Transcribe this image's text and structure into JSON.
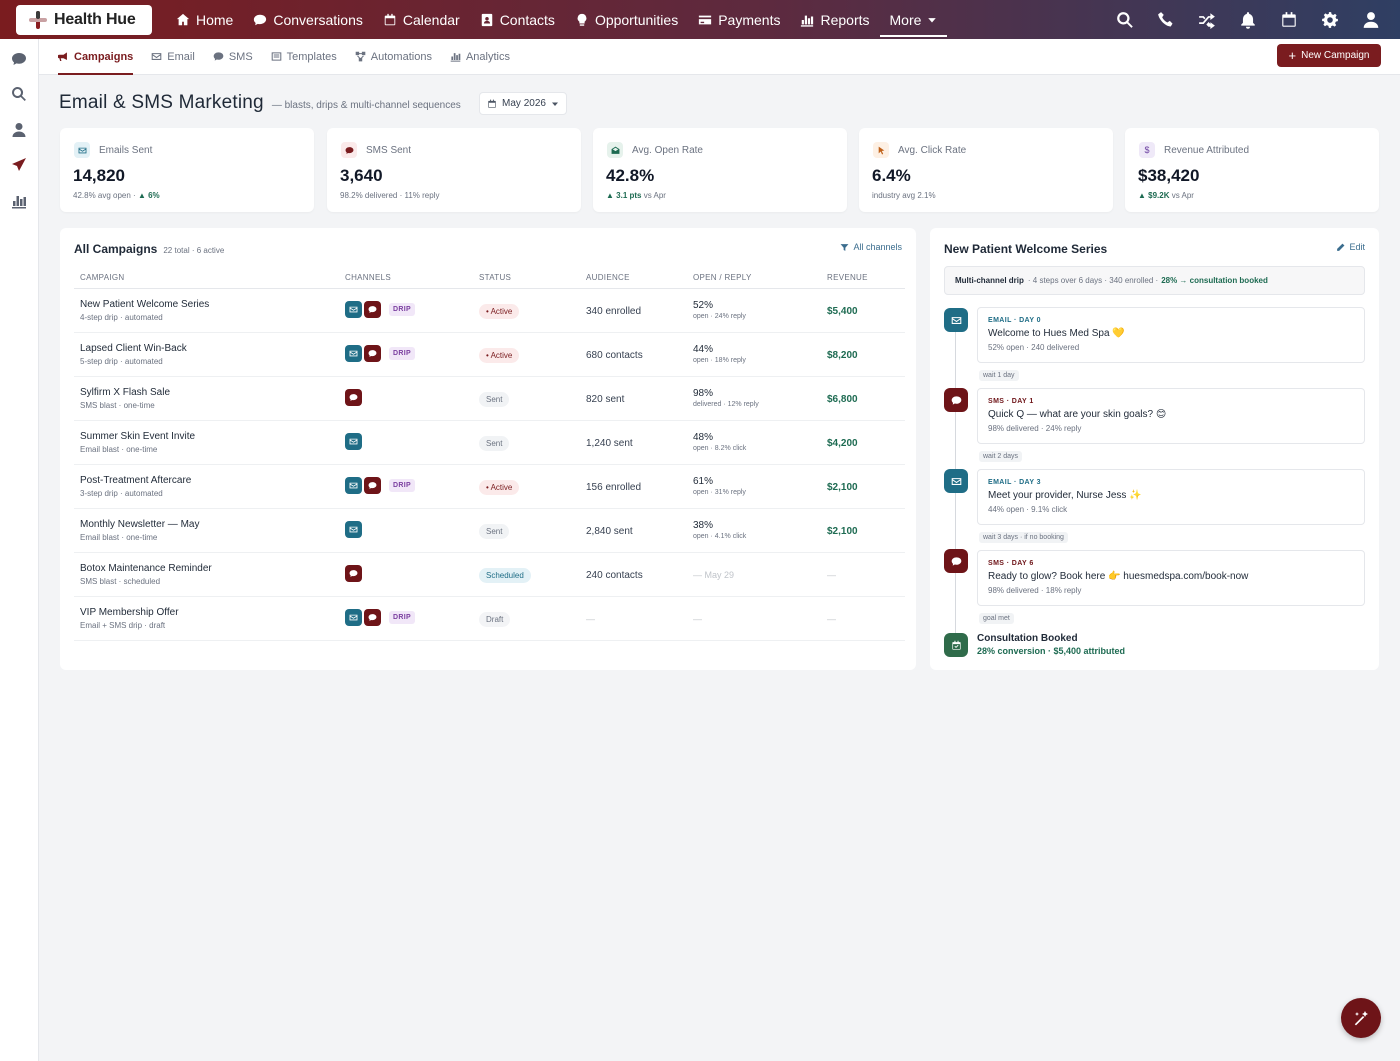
{
  "app": {
    "name": "Health Hue"
  },
  "topnav": [
    {
      "label": "Home",
      "icon": "home-icon"
    },
    {
      "label": "Conversations",
      "icon": "chat-icon"
    },
    {
      "label": "Calendar",
      "icon": "calendar-icon"
    },
    {
      "label": "Contacts",
      "icon": "contacts-icon"
    },
    {
      "label": "Opportunities",
      "icon": "lightbulb-icon"
    },
    {
      "label": "Payments",
      "icon": "credit-card-icon"
    },
    {
      "label": "Reports",
      "icon": "bar-chart-icon"
    }
  ],
  "more_label": "More",
  "top_icons": [
    "search-icon",
    "phone-icon",
    "shuffle-icon",
    "bell-icon",
    "calendar-icon",
    "gear-icon",
    "user-icon"
  ],
  "sidebar_icons": [
    "chat-icon",
    "search-icon",
    "user-icon",
    "send-icon",
    "bar-chart-icon"
  ],
  "subnav": {
    "tabs": [
      {
        "label": "Campaigns",
        "icon": "megaphone-icon",
        "active": true
      },
      {
        "label": "Email",
        "icon": "envelope-icon"
      },
      {
        "label": "SMS",
        "icon": "chat-icon"
      },
      {
        "label": "Templates",
        "icon": "template-icon"
      },
      {
        "label": "Automations",
        "icon": "workflow-icon"
      },
      {
        "label": "Analytics",
        "icon": "bar-chart-icon"
      }
    ],
    "new_button": "New Campaign"
  },
  "page": {
    "title": "Email & SMS Marketing",
    "subtitle": "— blasts, drips & multi-channel sequences",
    "month": "May 2026"
  },
  "stats": [
    {
      "label": "Emails Sent",
      "value": "14,820",
      "sub": "42.8% avg open ·",
      "up": "▲ 6%",
      "after": "",
      "icon": "envelope-icon",
      "icon_bg": "#e3f1f6",
      "icon_color": "#1f6d86"
    },
    {
      "label": "SMS Sent",
      "value": "3,640",
      "sub": "98.2% delivered · 11% reply",
      "up": "",
      "after": "",
      "icon": "chat-icon",
      "icon_bg": "#fbeaea",
      "icon_color": "#7a1c1f"
    },
    {
      "label": "Avg. Open Rate",
      "value": "42.8%",
      "sub": "",
      "up": "▲ 3.1 pts",
      "after": "vs Apr",
      "icon": "envelope-open-icon",
      "icon_bg": "#e6f2ec",
      "icon_color": "#1e6b52"
    },
    {
      "label": "Avg. Click Rate",
      "value": "6.4%",
      "sub": "industry avg 2.1%",
      "up": "",
      "after": "",
      "icon": "cursor-icon",
      "icon_bg": "#fdf0e4",
      "icon_color": "#c0621b"
    },
    {
      "label": "Revenue Attributed",
      "value": "$38,420",
      "sub": "",
      "up": "▲ $9.2K",
      "after": "vs Apr",
      "icon": "dollar-icon",
      "icon_bg": "#efe9f8",
      "icon_color": "#6b3fa0"
    }
  ],
  "campaigns": {
    "title": "All Campaigns",
    "meta": "22 total · 6 active",
    "filter": "All channels",
    "columns": [
      "CAMPAIGN",
      "CHANNELS",
      "STATUS",
      "AUDIENCE",
      "OPEN / REPLY",
      "REVENUE"
    ],
    "rows": [
      {
        "name": "New Patient Welcome Series",
        "meta": "4-step drip · automated",
        "email": true,
        "sms": true,
        "drip": "DRIP",
        "status": "• Active",
        "status_type": "active",
        "audience": "340 enrolled",
        "rate": "52%",
        "rate_sub": "open · 24% reply",
        "revenue": "$5,400"
      },
      {
        "name": "Lapsed Client Win-Back",
        "meta": "5-step drip · automated",
        "email": true,
        "sms": true,
        "drip": "DRIP",
        "status": "• Active",
        "status_type": "active",
        "audience": "680 contacts",
        "rate": "44%",
        "rate_sub": "open · 18% reply",
        "revenue": "$8,200"
      },
      {
        "name": "Sylfirm X Flash Sale",
        "meta": "SMS blast · one-time",
        "email": false,
        "sms": true,
        "drip": "",
        "status": "Sent",
        "status_type": "sent",
        "audience": "820 sent",
        "rate": "98%",
        "rate_sub": "delivered · 12% reply",
        "revenue": "$6,800"
      },
      {
        "name": "Summer Skin Event Invite",
        "meta": "Email blast · one-time",
        "email": true,
        "sms": false,
        "drip": "",
        "status": "Sent",
        "status_type": "sent",
        "audience": "1,240 sent",
        "rate": "48%",
        "rate_sub": "open · 8.2% click",
        "revenue": "$4,200"
      },
      {
        "name": "Post-Treatment Aftercare",
        "meta": "3-step drip · automated",
        "email": true,
        "sms": true,
        "drip": "DRIP",
        "status": "• Active",
        "status_type": "active",
        "audience": "156 enrolled",
        "rate": "61%",
        "rate_sub": "open · 31% reply",
        "revenue": "$2,100"
      },
      {
        "name": "Monthly Newsletter — May",
        "meta": "Email blast · one-time",
        "email": true,
        "sms": false,
        "drip": "",
        "status": "Sent",
        "status_type": "sent",
        "audience": "2,840 sent",
        "rate": "38%",
        "rate_sub": "open · 4.1% click",
        "revenue": "$2,100"
      },
      {
        "name": "Botox Maintenance Reminder",
        "meta": "SMS blast · scheduled",
        "email": false,
        "sms": true,
        "drip": "",
        "status": "Scheduled",
        "status_type": "scheduled",
        "audience": "240 contacts",
        "rate": "",
        "rate_muted": "— May 29",
        "rate_sub": "",
        "revenue": "",
        "revenue_muted": "—"
      },
      {
        "name": "VIP Membership Offer",
        "meta": "Email + SMS drip · draft",
        "email": true,
        "sms": true,
        "drip": "DRIP",
        "status": "Draft",
        "status_type": "draft",
        "audience": "",
        "audience_muted": "—",
        "rate": "",
        "rate_muted": "—",
        "rate_sub": "",
        "revenue": "",
        "revenue_muted": "—"
      }
    ]
  },
  "sequence": {
    "title": "New Patient Welcome Series",
    "edit": "Edit",
    "summary_label": "Multi-channel drip",
    "summary_meta": "· 4 steps over 6 days · 340 enrolled ·",
    "summary_highlight": "28% → consultation booked",
    "steps": [
      {
        "type": "EMAIL · DAY 0",
        "kind": "email",
        "title": "Welcome to Hues Med Spa 💛",
        "meta": "52% open · 240 delivered"
      },
      {
        "type": "SMS · DAY 1",
        "kind": "sms",
        "title": "Quick Q — what are your skin goals? 😊",
        "meta": "98% delivered · 24% reply"
      },
      {
        "type": "EMAIL · DAY 3",
        "kind": "email",
        "title": "Meet your provider, Nurse Jess ✨",
        "meta": "44% open · 9.1% click"
      },
      {
        "type": "SMS · DAY 6",
        "kind": "sms",
        "title": "Ready to glow? Book here 👉 huesmedspa.com/book-now",
        "meta": "98% delivered · 18% reply"
      }
    ],
    "waits": [
      "wait 1 day",
      "wait 2 days",
      "wait 3 days · if no booking",
      "goal met"
    ],
    "goal": {
      "title": "Consultation Booked",
      "sub": "28% conversion · $5,400 attributed"
    }
  },
  "colors": {
    "brand": "#7a1c1f",
    "email": "#1f6d86",
    "sms": "#6e1418",
    "positive": "#1e6b52",
    "goal": "#2f6b4a"
  }
}
